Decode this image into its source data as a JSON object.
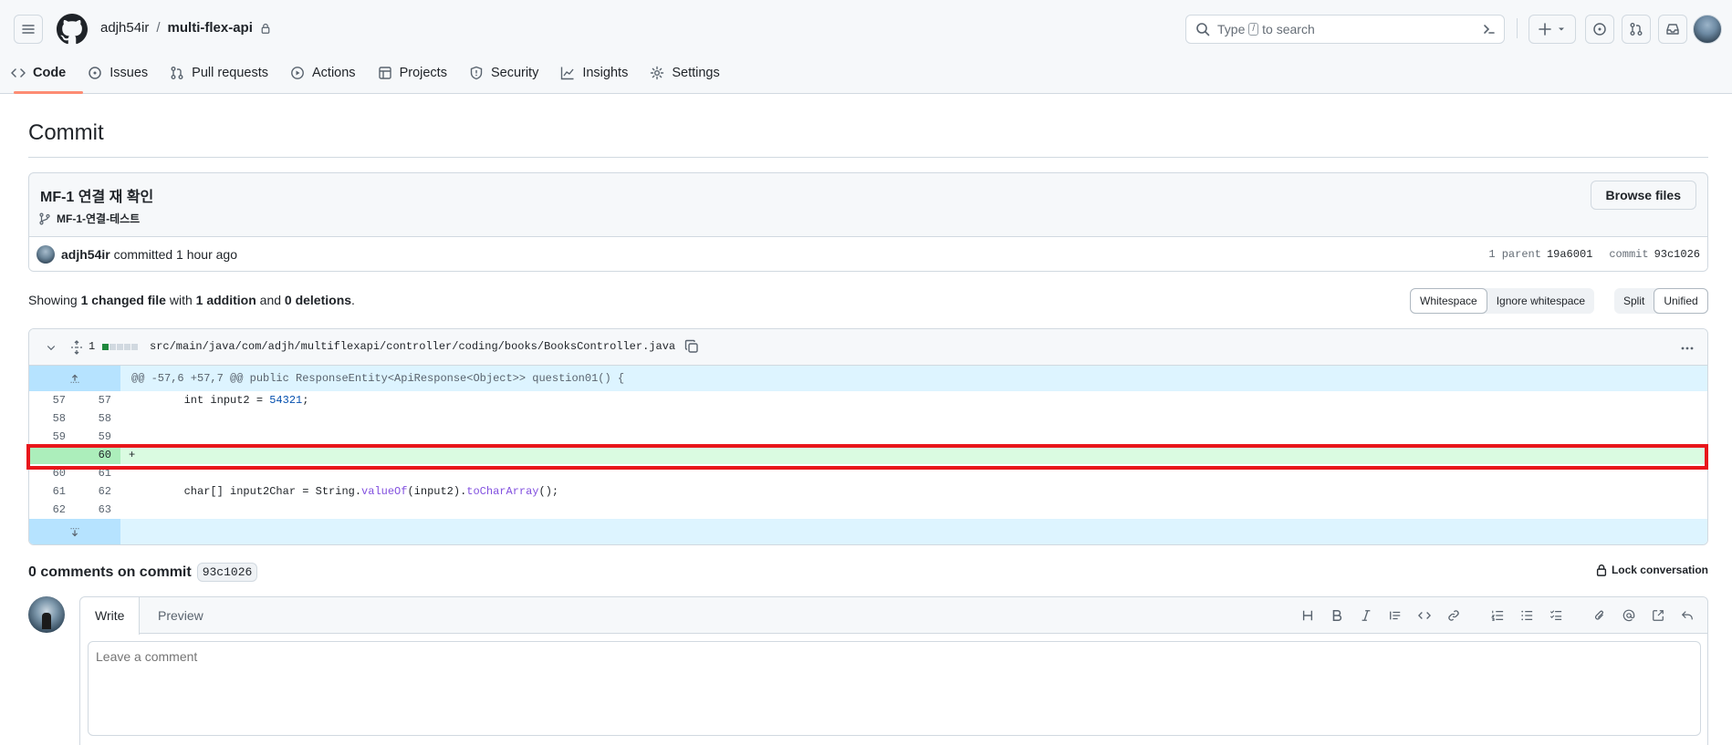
{
  "header": {
    "owner": "adjh54ir",
    "separator": "/",
    "repo": "multi-flex-api",
    "search_prefix": "Type",
    "search_key": "/",
    "search_suffix": "to search",
    "plus_label": "+"
  },
  "tabs": [
    {
      "label": "Code",
      "icon": "code-icon"
    },
    {
      "label": "Issues",
      "icon": "issue-icon"
    },
    {
      "label": "Pull requests",
      "icon": "pull-request-icon"
    },
    {
      "label": "Actions",
      "icon": "play-icon"
    },
    {
      "label": "Projects",
      "icon": "table-icon"
    },
    {
      "label": "Security",
      "icon": "shield-icon"
    },
    {
      "label": "Insights",
      "icon": "graph-icon"
    },
    {
      "label": "Settings",
      "icon": "gear-icon"
    }
  ],
  "page": {
    "title": "Commit"
  },
  "commit": {
    "message": "MF-1 연결 재 확인",
    "branch": "MF-1-연결-테스트",
    "browse_label": "Browse files",
    "author": "adjh54ir",
    "action_text": "committed 1 hour ago",
    "parent_label": "1 parent",
    "parent_sha": "19a6001",
    "commit_label": "commit",
    "commit_sha": "93c1026"
  },
  "summary": {
    "showing": "Showing",
    "files": "1 changed file",
    "with": "with",
    "additions": "1 addition",
    "and": "and",
    "deletions": "0 deletions",
    "period": "."
  },
  "whitespace": {
    "option_a": "Whitespace",
    "option_b": "Ignore whitespace"
  },
  "view_mode": {
    "option_a": "Split",
    "option_b": "Unified"
  },
  "diff": {
    "change_count": "1",
    "file_path": "src/main/java/com/adjh/multiflexapi/controller/coding/books/BooksController.java",
    "hunk_header": "@@ -57,6 +57,7 @@ public ResponseEntity<ApiResponse<Object>> question01() {",
    "lines": [
      {
        "old": "57",
        "new": "57",
        "text": "        int input2 = ",
        "num": "54321",
        "tail": ";"
      },
      {
        "old": "58",
        "new": "58",
        "text": ""
      },
      {
        "old": "59",
        "new": "59",
        "text": ""
      },
      {
        "old": "",
        "new": "60",
        "text": "+",
        "added": true
      },
      {
        "old": "60",
        "new": "61",
        "text": ""
      },
      {
        "old": "61",
        "new": "62",
        "text": "        char[] input2Char = String.",
        "fn1": "valueOf",
        "mid": "(input2).",
        "fn2": "toCharArray",
        "tail": "();"
      },
      {
        "old": "62",
        "new": "63",
        "text": ""
      }
    ]
  },
  "comments": {
    "count_title": "0 comments on commit",
    "sha": "93c1026",
    "lock_label": "Lock conversation",
    "write_tab": "Write",
    "preview_tab": "Preview",
    "placeholder": "Leave a comment"
  },
  "colors": {
    "accent_tab": "#fd8c73",
    "add_bg": "#dafbe1",
    "hunk_bg": "#ddf4ff",
    "highlight": "#e8161b"
  }
}
